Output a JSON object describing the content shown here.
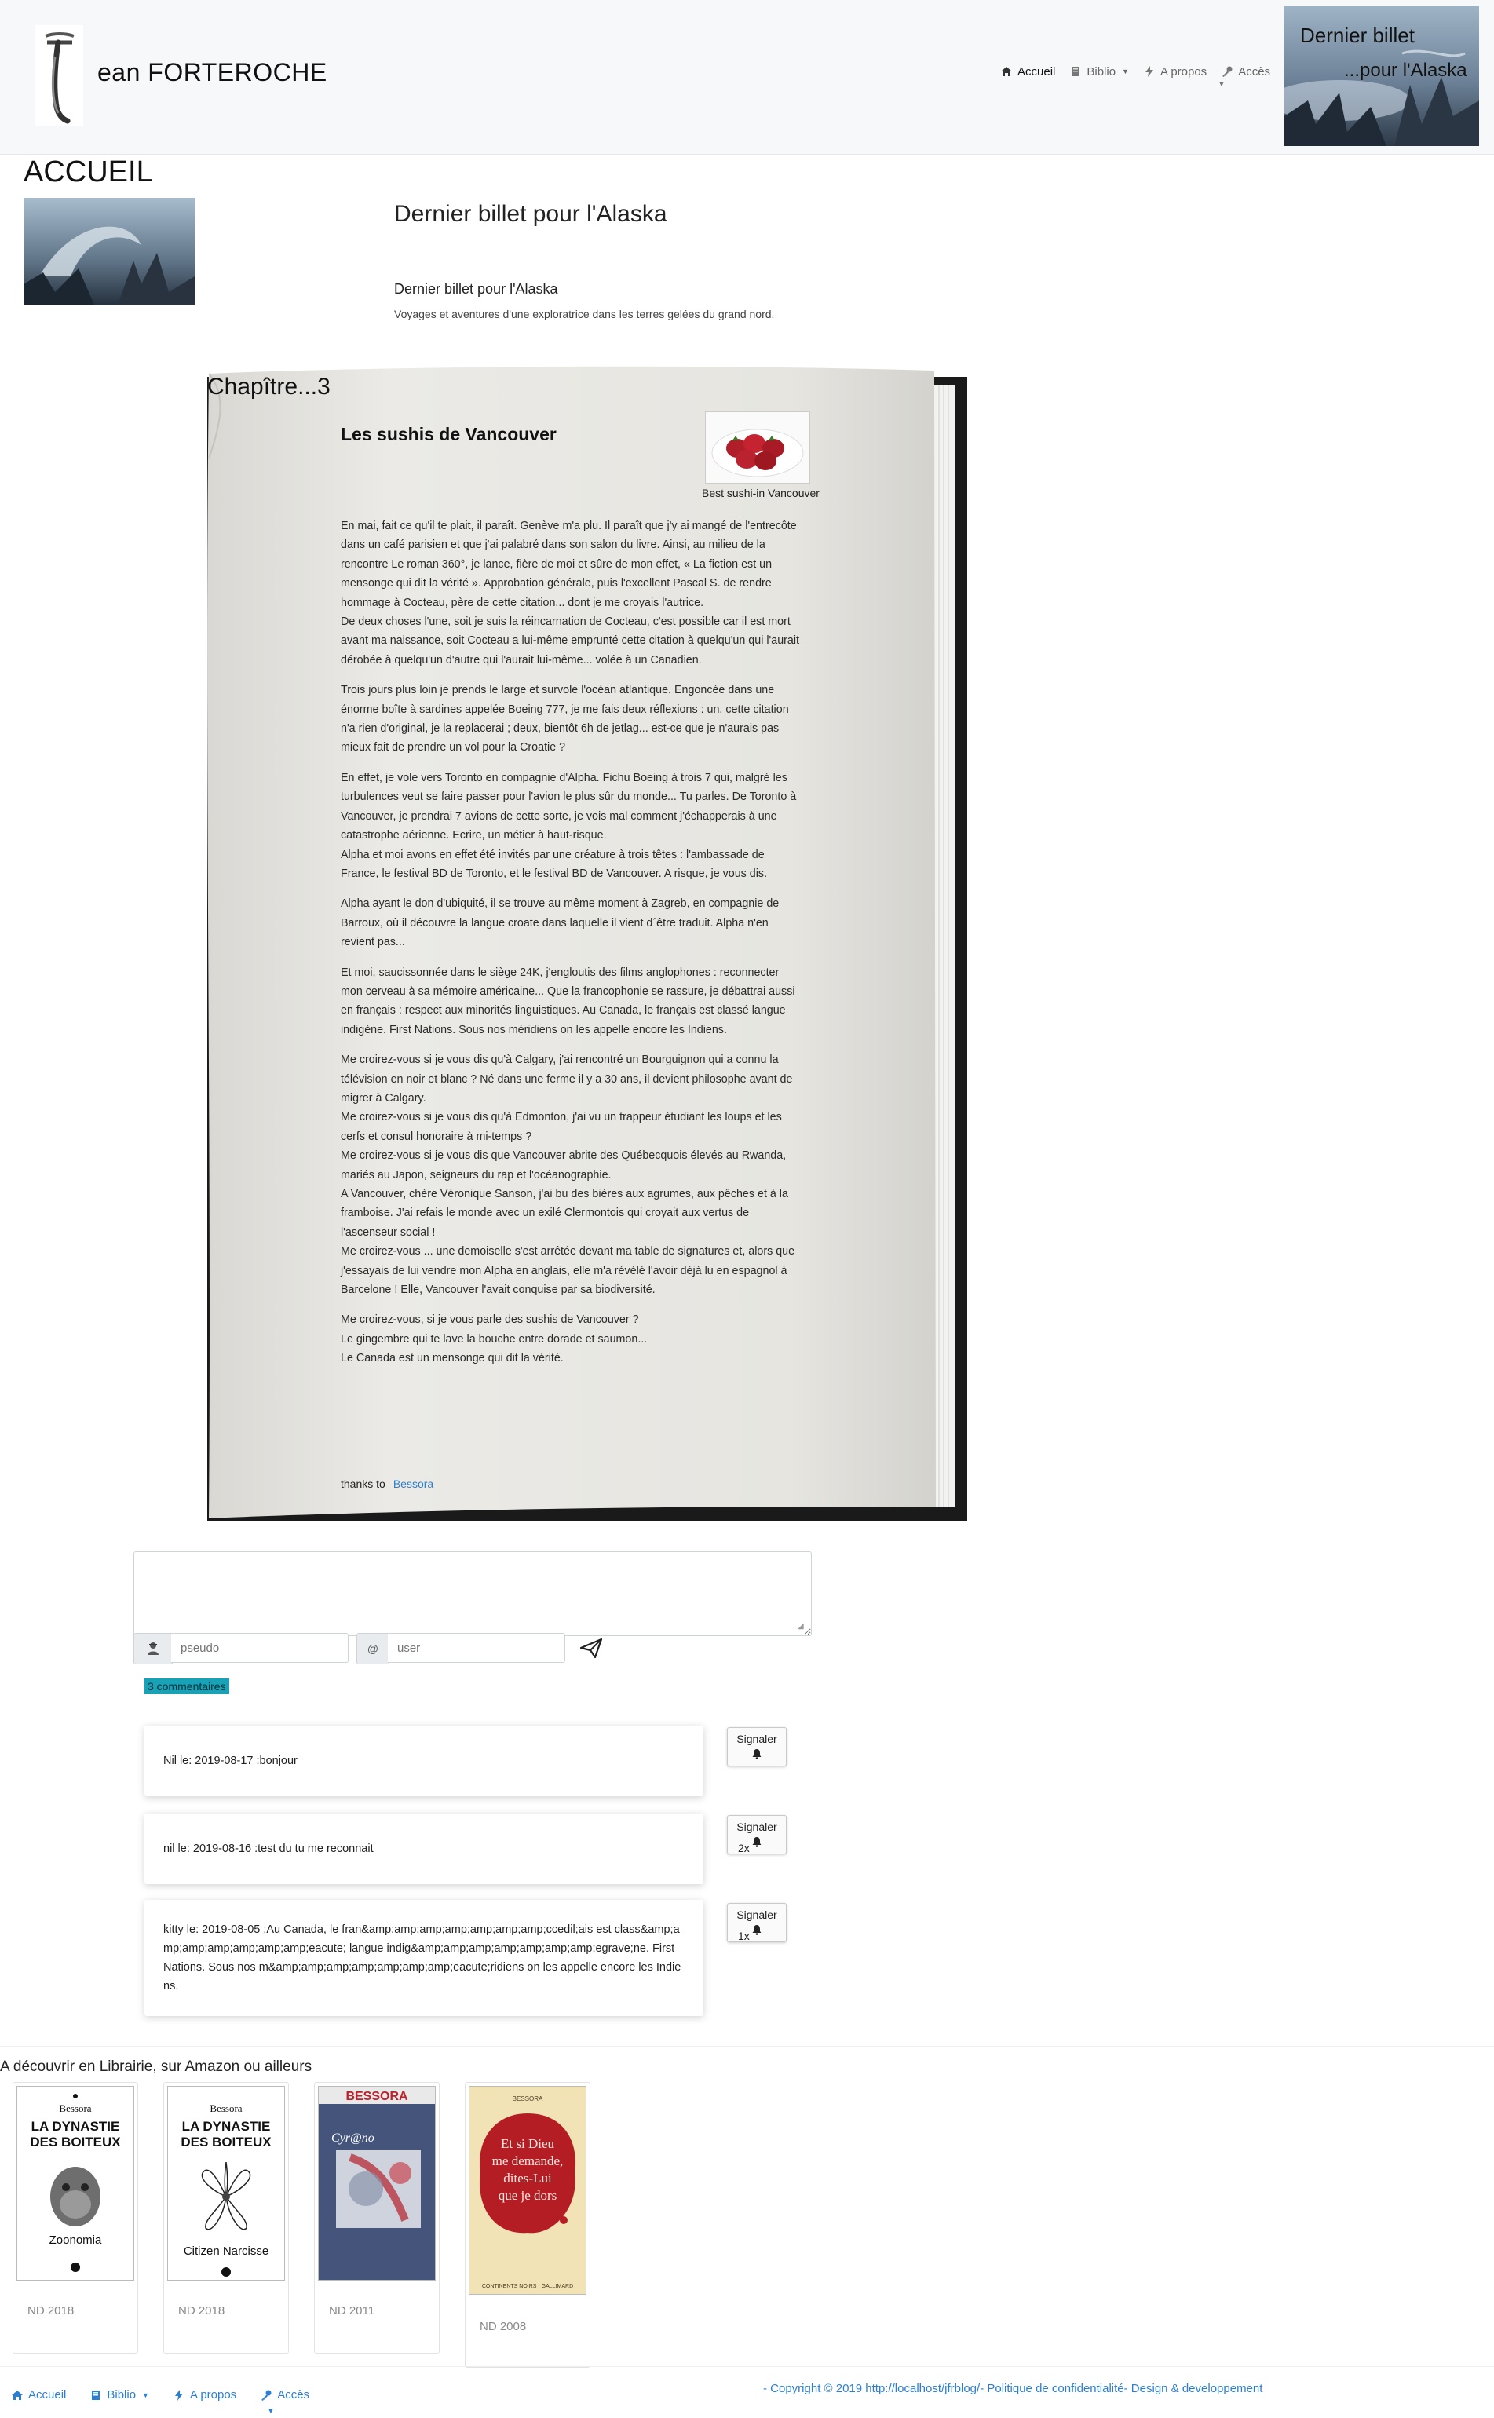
{
  "header": {
    "site_title": "ean FORTEROCHE",
    "nav": {
      "home": "Accueil",
      "biblio": "Biblio",
      "about": "A propos",
      "access": "Accès"
    },
    "hero": {
      "line1": "Dernier billet",
      "line2": "...pour l'Alaska"
    },
    "icons": [
      "home-icon",
      "book-icon",
      "bolt-icon",
      "key-icon"
    ]
  },
  "page": {
    "title": "ACCUEIL",
    "book_title": "Dernier billet pour l'Alaska",
    "book_subtitle": "Dernier billet pour l'Alaska",
    "book_description": "Voyages et aventures d'une exploratrice dans les terres gelées du grand nord."
  },
  "chapter": {
    "label": "Chapître...3",
    "title": "Les sushis de Vancouver",
    "image_caption": "Best sushi-in Vancouver",
    "paragraphs": [
      "En mai, fait ce qu'il te plait, il paraît. Genève m'a plu. Il paraît que j'y ai mangé de l'entrecôte dans un café parisien et que j'ai palabré dans son salon du livre. Ainsi, au milieu de la rencontre Le roman 360°, je lance, fière de moi et sûre de mon effet, « La fiction est un mensonge qui dit la vérité ». Approbation générale, puis l'excellent Pascal S. de rendre hommage à Cocteau, père de cette citation... dont je me croyais l'autrice.",
      "De deux choses l'une, soit je suis la réincarnation de Cocteau, c'est possible car il est mort avant ma naissance, soit Cocteau a lui-même emprunté cette citation à quelqu'un qui l'aurait dérobée à quelqu'un d'autre qui l'aurait lui-même... volée à un Canadien.",
      "Trois jours plus loin je prends le large et survole l'océan atlantique. Engoncée dans une énorme boîte à sardines appelée Boeing 777, je me fais deux réflexions : un, cette citation n'a rien d'original, je la replacerai ; deux, bientôt 6h de jetlag... est-ce que je n'aurais pas mieux fait de prendre un vol pour la Croatie ?",
      "En effet, je vole vers Toronto en compagnie d'Alpha. Fichu Boeing à trois 7 qui, malgré les turbulences veut se faire passer pour l'avion le plus sûr du monde... Tu parles. De Toronto à Vancouver, je prendrai 7 avions de cette sorte, je vois mal comment j'échapperais à une catastrophe aérienne. Ecrire, un métier à haut-risque.",
      "Alpha et moi avons en effet été invités par une créature à trois têtes : l'ambassade de France, le festival BD de Toronto, et le festival BD de Vancouver. A risque, je vous dis.",
      "Alpha ayant le don d'ubiquité, il se trouve au même moment à Zagreb, en compagnie de Barroux, où il découvre la langue croate dans laquelle il vient d´être traduit. Alpha n'en revient pas...",
      "Et moi, saucissonnée dans le siège 24K, j'engloutis des films anglophones : reconnecter mon cerveau à sa mémoire américaine... Que la francophonie se rassure, je débattrai aussi en français : respect aux minorités linguistiques. Au Canada, le français est classé langue indigène. First Nations. Sous nos méridiens on les appelle encore les Indiens.",
      "Me croirez-vous si je vous dis qu'à Calgary, j'ai rencontré un Bourguignon qui a connu la télévision en noir et blanc ? Né dans une ferme il y a 30 ans, il devient philosophe avant de migrer à Calgary.",
      "Me croirez-vous si je vous dis qu'à Edmonton, j'ai vu un trappeur étudiant les loups et les cerfs et consul honoraire à mi-temps ?",
      "Me croirez-vous si je vous dis que Vancouver abrite des Québecquois élevés au Rwanda, mariés au Japon, seigneurs du rap et l'océanographie.",
      "A Vancouver, chère Véronique Sanson, j'ai bu des bières aux agrumes, aux pêches et à la framboise. J'ai refais le monde avec un exilé Clermontois qui croyait aux vertus de l'ascenseur social !",
      "Me croirez-vous ... une demoiselle s'est arrêtée devant ma table de signatures et, alors que j'essayais de lui vendre mon Alpha en anglais, elle m'a révélé l'avoir déjà lu en espagnol à Barcelone ! Elle, Vancouver l'avait conquise par sa biodiversité.",
      "Me croirez-vous, si je vous parle des sushis de Vancouver ?",
      "Le gingembre qui te lave la bouche entre dorade et saumon...",
      "Le Canada est un mensonge qui dit la vérité."
    ],
    "thanks_prefix": "thanks to",
    "thanks_link": "Bessora"
  },
  "comments": {
    "form": {
      "pseudo_placeholder": "pseudo",
      "at_symbol": "@",
      "user_placeholder": "user"
    },
    "count_label": "3 commentaires",
    "report_label": "Signaler",
    "items": [
      {
        "text": "Nil le: 2019-08-17 :bonjour",
        "reports": ""
      },
      {
        "text": "nil le: 2019-08-16 :test du tu me reconnait",
        "reports": "2x"
      },
      {
        "text": "kitty le: 2019-08-05 :Au Canada, le fran&amp;amp;amp;amp;amp;amp;amp;ccedil;ais est class&amp;amp;amp;amp;amp;amp;amp;eacute; langue indig&amp;amp;amp;amp;amp;amp;amp;egrave;ne. First Nations. Sous nos m&amp;amp;amp;amp;amp;amp;amp;eacute;ridiens on les appelle encore les Indiens.",
        "reports": "1x"
      }
    ]
  },
  "shop": {
    "title": "A découvrir en Librairie, sur Amazon ou ailleurs",
    "books": [
      {
        "author": "Bessora",
        "title": "LA DYNASTIE DES BOITEUX",
        "subtitle": "Zoonomia",
        "year": "ND 2018"
      },
      {
        "author": "Bessora",
        "title": "LA DYNASTIE DES BOITEUX",
        "subtitle": "Citizen Narcisse",
        "year": "ND 2018"
      },
      {
        "author": "BESSORA",
        "title": "Cyr@no",
        "subtitle": "",
        "year": "ND 2011"
      },
      {
        "author": "BESSORA",
        "title": "Et si Dieu me demande, dites-Lui que je dors",
        "subtitle": "CONTINENTS NOIRS · GALLIMARD",
        "year": "ND 2008"
      }
    ]
  },
  "footer": {
    "nav": {
      "home": "Accueil",
      "biblio": "Biblio",
      "about": "A propos",
      "access": "Accès"
    },
    "copyright": "- Copyright © 2019 http://localhost/jfrblog/- Politique de confidentialité- Design & developpement"
  },
  "colors": {
    "link": "#2a7fd4",
    "badge": "#17a2b8",
    "header_bg": "#f7f8fa",
    "page_paper": "#e8e7e2"
  }
}
